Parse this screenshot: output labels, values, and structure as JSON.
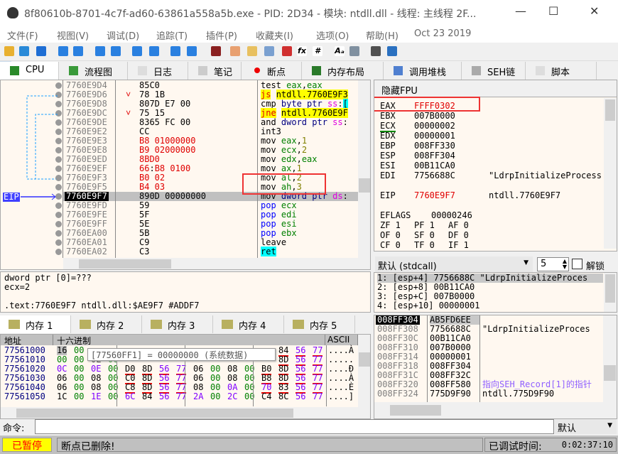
{
  "window": {
    "title": "8f80610b-8701-4c7f-ad60-63861a558a5b.exe - PID: 2D34 - 模块: ntdll.dll - 线程: 主线程 2F...",
    "minimize": "—",
    "maximize": "☐",
    "close": "✕"
  },
  "menu": [
    "文件(F)",
    "视图(V)",
    "调试(D)",
    "追踪(T)",
    "插件(P)",
    "收藏夹(I)",
    "选项(O)",
    "帮助(H)",
    "Oct 23 2019"
  ],
  "toolbar_icons": [
    "open-icon",
    "restart-icon",
    "stop-icon",
    "run-icon",
    "pause-icon",
    "step-into-icon",
    "step-over-icon",
    "trace-into-icon",
    "trace-over-icon",
    "execute-till-return-icon",
    "run-to-user-code-icon",
    "script-icon",
    "patch-icon",
    "comment-icon",
    "label-icon",
    "bookmark-icon",
    "function-icon",
    "hash-icon",
    "font-icon",
    "device-icon",
    "calculator-icon",
    "globe-icon"
  ],
  "tabs": [
    {
      "label": "CPU",
      "icon": "cpu-icon"
    },
    {
      "label": "流程图",
      "icon": "tree-icon"
    },
    {
      "label": "日志",
      "icon": "log-icon"
    },
    {
      "label": "笔记",
      "icon": "notes-icon"
    },
    {
      "label": "断点",
      "icon": "breakpoint-icon"
    },
    {
      "label": "内存布局",
      "icon": "memory-map-icon"
    },
    {
      "label": "调用堆栈",
      "icon": "call-stack-icon"
    },
    {
      "label": "SEH链",
      "icon": "seh-icon"
    },
    {
      "label": "脚本",
      "icon": "script-icon"
    }
  ],
  "disasm": {
    "eip_label": "EIP",
    "rows": [
      {
        "addr": "7760E9D4",
        "jmp": "",
        "bytes": [
          [
            "85C0",
            ""
          ]
        ],
        "ins": [
          [
            "test ",
            ""
          ],
          [
            "eax",
            "green"
          ],
          [
            ",",
            ""
          ],
          [
            "eax",
            "green"
          ]
        ]
      },
      {
        "addr": "7760E9D6",
        "jmp": "˅",
        "bytes": [
          [
            "78 1B",
            ""
          ]
        ],
        "ins": [
          [
            "js",
            "hly red"
          ],
          [
            " ",
            ""
          ],
          [
            "ntdll.7760E9F3",
            "hly"
          ]
        ]
      },
      {
        "addr": "7760E9D8",
        "jmp": "",
        "bytes": [
          [
            "807D E7 00",
            ""
          ]
        ],
        "ins": [
          [
            "cmp ",
            ""
          ],
          [
            "byte ptr ",
            "navy"
          ],
          [
            "ss",
            "mag"
          ],
          [
            ":",
            ""
          ],
          [
            "[",
            "hlc"
          ]
        ]
      },
      {
        "addr": "7760E9DC",
        "jmp": "˅",
        "bytes": [
          [
            "75 15",
            ""
          ]
        ],
        "ins": [
          [
            "jne",
            "hly red"
          ],
          [
            " ",
            ""
          ],
          [
            "ntdll.7760E9F",
            "hly"
          ]
        ]
      },
      {
        "addr": "7760E9DE",
        "jmp": "",
        "bytes": [
          [
            "8365 FC 00",
            ""
          ]
        ],
        "ins": [
          [
            "and ",
            ""
          ],
          [
            "dword ptr ",
            "navy"
          ],
          [
            "ss",
            "mag"
          ],
          [
            ":",
            ""
          ]
        ]
      },
      {
        "addr": "7760E9E2",
        "jmp": "",
        "bytes": [
          [
            "CC",
            ""
          ]
        ],
        "ins": [
          [
            "int3",
            ""
          ]
        ]
      },
      {
        "addr": "7760E9E3",
        "jmp": "",
        "bytes": [
          [
            "B8 01000000",
            "red"
          ]
        ],
        "ins": [
          [
            "mov ",
            ""
          ],
          [
            "eax",
            "green"
          ],
          [
            ",",
            ""
          ],
          [
            "1",
            "olive"
          ]
        ]
      },
      {
        "addr": "7760E9E8",
        "jmp": "",
        "bytes": [
          [
            "B9 02000000",
            "red"
          ]
        ],
        "ins": [
          [
            "mov ",
            ""
          ],
          [
            "ecx",
            "green"
          ],
          [
            ",",
            ""
          ],
          [
            "2",
            "olive"
          ]
        ]
      },
      {
        "addr": "7760E9ED",
        "jmp": "",
        "bytes": [
          [
            "8BD0",
            "red"
          ]
        ],
        "ins": [
          [
            "mov ",
            ""
          ],
          [
            "edx",
            "green"
          ],
          [
            ",",
            ""
          ],
          [
            "eax",
            "green"
          ]
        ]
      },
      {
        "addr": "7760E9EF",
        "jmp": "",
        "bytes": [
          [
            "66",
            "red"
          ],
          [
            ":",
            ""
          ],
          [
            "B8 0100",
            "red"
          ]
        ],
        "ins": [
          [
            "mov ",
            ""
          ],
          [
            "ax",
            "green"
          ],
          [
            ",",
            ""
          ],
          [
            "1",
            "olive"
          ]
        ]
      },
      {
        "addr": "7760E9F3",
        "jmp": "",
        "bytes": [
          [
            "B0 02",
            "red"
          ]
        ],
        "ins": [
          [
            "mov ",
            ""
          ],
          [
            "al",
            "green"
          ],
          [
            ",",
            ""
          ],
          [
            "2",
            "olive"
          ]
        ]
      },
      {
        "addr": "7760E9F5",
        "jmp": "",
        "bytes": [
          [
            "B4 03",
            "red"
          ]
        ],
        "ins": [
          [
            "mov ",
            ""
          ],
          [
            "ah",
            "green"
          ],
          [
            ",",
            ""
          ],
          [
            "3",
            "olive"
          ]
        ]
      },
      {
        "addr": "7760E9F7",
        "jmp": "",
        "current": true,
        "bytes": [
          [
            "890D 00000000",
            ""
          ]
        ],
        "ins": [
          [
            "mov ",
            ""
          ],
          [
            "dword ptr ",
            "navy"
          ],
          [
            "ds",
            "mag"
          ],
          [
            ":",
            ""
          ]
        ]
      },
      {
        "addr": "7760E9FD",
        "jmp": "",
        "bytes": [
          [
            "59",
            ""
          ]
        ],
        "ins": [
          [
            "pop ",
            "blue"
          ],
          [
            "ecx",
            "green"
          ]
        ]
      },
      {
        "addr": "7760E9FE",
        "jmp": "",
        "bytes": [
          [
            "5F",
            ""
          ]
        ],
        "ins": [
          [
            "pop ",
            "blue"
          ],
          [
            "edi",
            "green"
          ]
        ]
      },
      {
        "addr": "7760E9FF",
        "jmp": "",
        "bytes": [
          [
            "5E",
            ""
          ]
        ],
        "ins": [
          [
            "pop ",
            "blue"
          ],
          [
            "esi",
            "green"
          ]
        ]
      },
      {
        "addr": "7760EA00",
        "jmp": "",
        "bytes": [
          [
            "5B",
            ""
          ]
        ],
        "ins": [
          [
            "pop ",
            "blue"
          ],
          [
            "ebx",
            "green"
          ]
        ]
      },
      {
        "addr": "7760EA01",
        "jmp": "",
        "bytes": [
          [
            "C9",
            ""
          ]
        ],
        "ins": [
          [
            "leave",
            ""
          ]
        ]
      },
      {
        "addr": "7760EA02",
        "jmp": "",
        "bytes": [
          [
            "C3",
            ""
          ]
        ],
        "ins": [
          [
            "ret",
            "hlc"
          ]
        ]
      }
    ]
  },
  "info": {
    "lines": [
      "dword ptr [0]=???",
      "ecx=2",
      "",
      ".text:7760E9F7 ntdll.dll:$AE9F7 #ADDF7"
    ]
  },
  "registers": {
    "header": "隐藏FPU",
    "gprs": [
      {
        "name": "EAX",
        "value": "FFFF0302",
        "changed": true,
        "comment": ""
      },
      {
        "name": "EBX",
        "value": "007B0000",
        "comment": ""
      },
      {
        "name": "ECX",
        "value": "00000002",
        "comment": ""
      },
      {
        "name": "EDX",
        "value": "00000001",
        "comment": ""
      },
      {
        "name": "EBP",
        "value": "008FF330",
        "comment": ""
      },
      {
        "name": "ESP",
        "value": "008FF304",
        "comment": ""
      },
      {
        "name": "ESI",
        "value": "00B11CA0",
        "comment": ""
      },
      {
        "name": "EDI",
        "value": "7756688C",
        "comment": "\"LdrpInitializeProcess"
      }
    ],
    "eip": {
      "name": "EIP",
      "value": "7760E9F7",
      "comment": "ntdll.7760E9F7"
    },
    "eflags": {
      "name": "EFLAGS",
      "value": "00000246"
    },
    "flags": [
      [
        "ZF 1",
        "PF 1",
        "AF 0"
      ],
      [
        "OF 0",
        "SF 0",
        "DF 0"
      ],
      [
        "CF 0",
        "TF 0",
        "IF 1"
      ]
    ]
  },
  "callconv": {
    "selected": "默认 (stdcall)",
    "count": "5",
    "unlock": "解锁",
    "args": [
      "1: [esp+4] 7756688C \"LdrpInitializeProces",
      "2: [esp+8] 00B11CA0",
      "3: [esp+C] 007B0000",
      "4: [esp+10] 00000001"
    ]
  },
  "memory": {
    "tabs": [
      "内存 1",
      "内存 2",
      "内存 3",
      "内存 4",
      "内存 5"
    ],
    "headers": {
      "addr": "地址",
      "hex": "十六进制",
      "ascii": "ASCII"
    },
    "tooltip": "[77560FF1] = 00000000 (系统数据)",
    "rows": [
      {
        "addr": "77561000",
        "bytes": [
          "16",
          "00",
          "",
          "",
          "",
          "",
          "",
          "",
          "",
          "",
          "",
          "",
          "",
          "84",
          "56",
          "77"
        ],
        "ascii": "....À"
      },
      {
        "addr": "77561010",
        "bytes": [
          "00",
          "00",
          "0E",
          "00",
          "",
          "",
          "",
          "",
          "",
          "",
          "",
          "",
          "",
          "8D",
          "56",
          "77"
        ],
        "ascii": "....."
      },
      {
        "addr": "77561020",
        "bytes": [
          "0C",
          "00",
          "0E",
          "00",
          "D0",
          "8D",
          "56",
          "77",
          "06",
          "00",
          "08",
          "00",
          "B0",
          "8D",
          "56",
          "77"
        ],
        "ascii": "....Ð"
      },
      {
        "addr": "77561030",
        "bytes": [
          "06",
          "00",
          "08",
          "00",
          "C0",
          "8D",
          "56",
          "77",
          "06",
          "00",
          "08",
          "00",
          "B8",
          "8D",
          "56",
          "77"
        ],
        "ascii": "....À"
      },
      {
        "addr": "77561040",
        "bytes": [
          "06",
          "00",
          "08",
          "00",
          "C8",
          "8D",
          "56",
          "77",
          "08",
          "00",
          "0A",
          "00",
          "70",
          "83",
          "56",
          "77"
        ],
        "ascii": "....È"
      },
      {
        "addr": "77561050",
        "bytes": [
          "1C",
          "00",
          "1E",
          "00",
          "6C",
          "84",
          "56",
          "77",
          "2A",
          "00",
          "2C",
          "00",
          "C4",
          "8C",
          "56",
          "77"
        ],
        "ascii": "....]"
      }
    ]
  },
  "stack": {
    "rows": [
      {
        "addr": "008FF304",
        "value": "AB5FD6EE",
        "comment": "",
        "current": true
      },
      {
        "addr": "008FF308",
        "value": "7756688C",
        "comment": "\"LdrpInitializeProces"
      },
      {
        "addr": "008FF30C",
        "value": "00B11CA0",
        "comment": ""
      },
      {
        "addr": "008FF310",
        "value": "007B0000",
        "comment": ""
      },
      {
        "addr": "008FF314",
        "value": "00000001",
        "comment": ""
      },
      {
        "addr": "008FF318",
        "value": "008FF304",
        "comment": ""
      },
      {
        "addr": "008FF31C",
        "value": "008FF32C",
        "comment": ""
      },
      {
        "addr": "008FF320",
        "value": "008FF580",
        "comment": "指向SEH_Record[1]的指针",
        "seh": true
      },
      {
        "addr": "008FF324",
        "value": "775D9F90",
        "comment": "ntdll.775D9F90"
      }
    ]
  },
  "command": {
    "label": "命令:",
    "value": "",
    "mode": "默认"
  },
  "status": {
    "state": "已暂停",
    "message": "断点已删除!",
    "time_label": "已调试时间:",
    "time": "0:02:37:10"
  },
  "colors": {
    "background": "#fff8f0",
    "highlight_red": "#ff0000",
    "paused_bg": "#ffff00",
    "eip_bg": "#4040ff"
  }
}
